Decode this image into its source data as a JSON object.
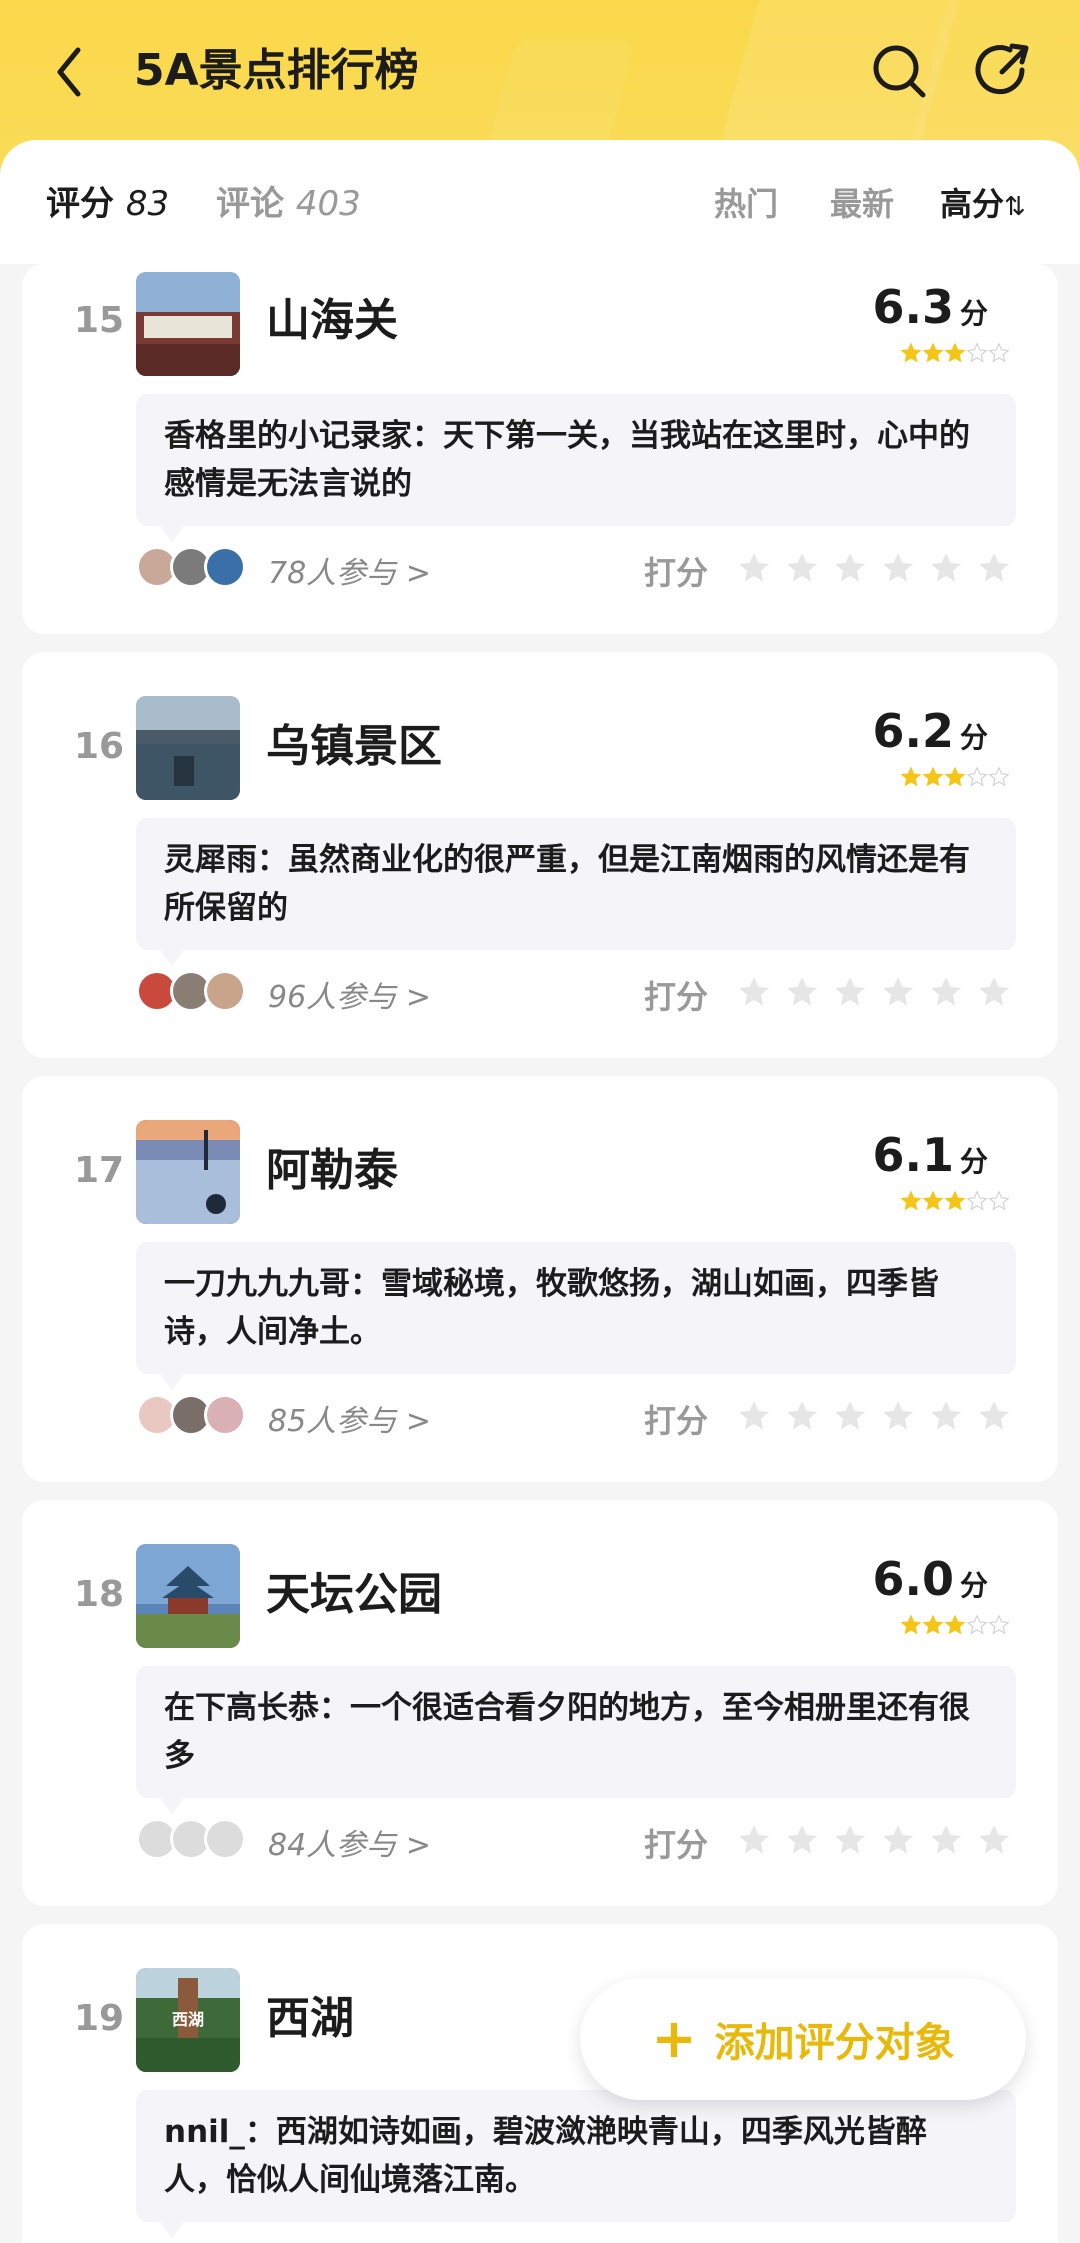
{
  "header": {
    "title": "5A景点排行榜",
    "back_icon": "chevron-left-icon",
    "search_icon": "search-icon",
    "share_icon": "share-icon",
    "bg_color": "#fbd84a"
  },
  "filter": {
    "score_label": "评分",
    "score_count": "83",
    "comment_label": "评论",
    "comment_count": "403",
    "sort_hot": "热门",
    "sort_new": "最新",
    "sort_high": "高分",
    "sort_arrow": "⇅"
  },
  "items": [
    {
      "rank": "15",
      "name": "山海关",
      "score": "6.3",
      "unit": "分",
      "stars_filled": 3,
      "comment": "香格里的小记录家：天下第一关，当我站在这里时，心中的感情是无法言说的",
      "participants": "78人参与 >",
      "rate_label": "打分"
    },
    {
      "rank": "16",
      "name": "乌镇景区",
      "score": "6.2",
      "unit": "分",
      "stars_filled": 3,
      "comment": "灵犀雨：虽然商业化的很严重，但是江南烟雨的风情还是有所保留的",
      "participants": "96人参与 >",
      "rate_label": "打分"
    },
    {
      "rank": "17",
      "name": "阿勒泰",
      "score": "6.1",
      "unit": "分",
      "stars_filled": 3,
      "comment": "一刀九九九哥：雪域秘境，牧歌悠扬，湖山如画，四季皆诗，人间净土。",
      "participants": "85人参与 >",
      "rate_label": "打分"
    },
    {
      "rank": "18",
      "name": "天坛公园",
      "score": "6.0",
      "unit": "分",
      "stars_filled": 3,
      "comment": "在下高长恭：一个很适合看夕阳的地方，至今相册里还有很多",
      "participants": "84人参与 >",
      "rate_label": "打分"
    },
    {
      "rank": "19",
      "name": "西湖",
      "thumb_text": "西湖",
      "comment": "nnil_：西湖如诗如画，碧波潋滟映青山，四季风光皆醉人，恰似人间仙境落江南。"
    }
  ],
  "fab": {
    "label": "添加评分对象",
    "icon": "plus-icon",
    "color": "#e8b90a"
  },
  "colors": {
    "star_gold": "#f5c518",
    "star_empty": "#e6e6e6"
  }
}
